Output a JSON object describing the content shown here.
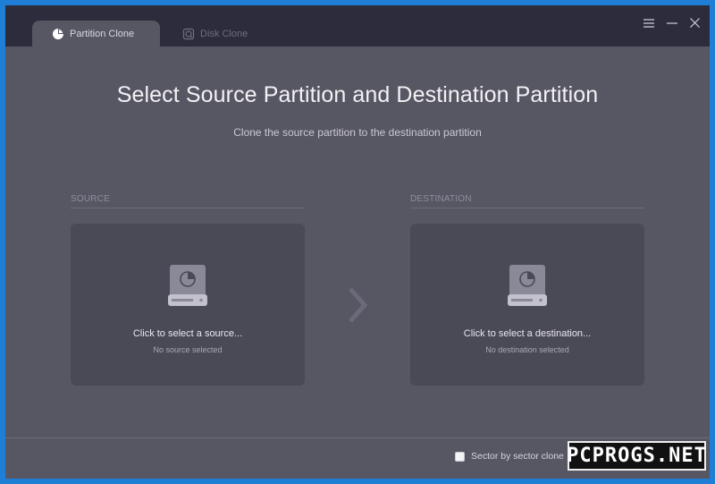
{
  "tabs": [
    {
      "label": "Partition Clone",
      "icon": "pie-chart-icon",
      "active": true
    },
    {
      "label": "Disk Clone",
      "icon": "disk-icon",
      "active": false
    }
  ],
  "window_controls": [
    "menu-icon",
    "minimize-icon",
    "close-icon"
  ],
  "main": {
    "title": "Select Source Partition and Destination Partition",
    "subtitle": "Clone the source partition to the destination partition"
  },
  "source": {
    "label": "SOURCE",
    "prompt": "Click to select a source...",
    "status": "No source selected"
  },
  "destination": {
    "label": "DESTINATION",
    "prompt": "Click to select a destination...",
    "status": "No destination selected"
  },
  "footer": {
    "sector_label": "Sector by sector clone",
    "sector_checked": false
  },
  "watermark": "PCPROGS.NET",
  "colors": {
    "window_bg": "#575663",
    "titlebar_bg": "#2c2c3c",
    "card_bg": "#4a4956",
    "desktop_bg": "#1f7fd6"
  }
}
